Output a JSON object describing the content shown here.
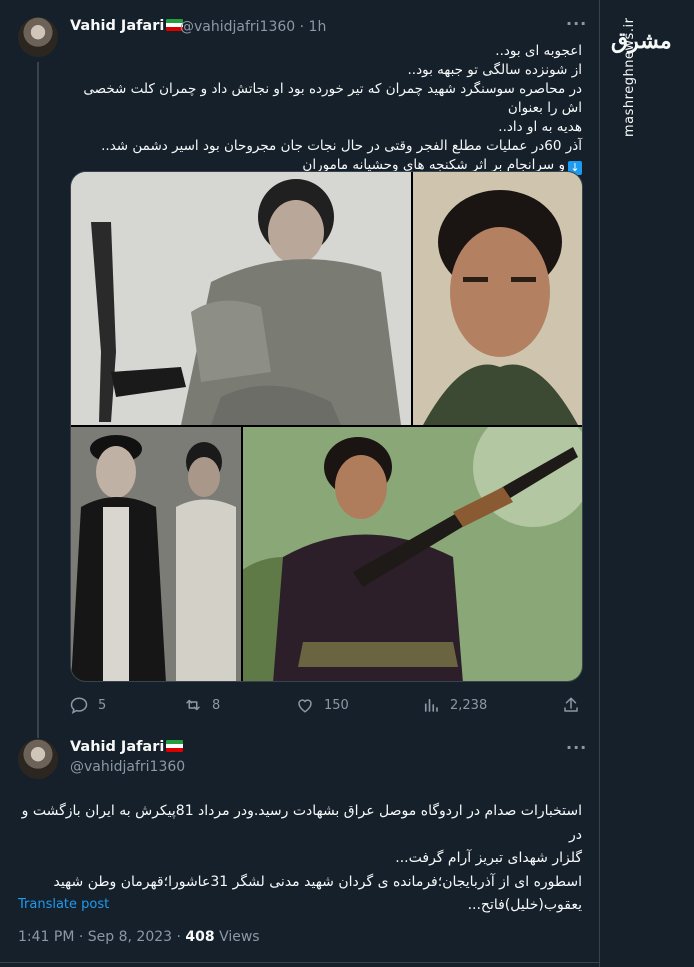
{
  "tweet1": {
    "name": "Vahid Jafari",
    "handle": "@vahidjafri1360 · 1h",
    "lines": [
      "اعجوبه ای بود..",
      "از شونزده سالگی تو جبهه بود..",
      "در محاصره سوسنگرد شهید چمران که تیر خورده بود او نجاتش داد و چمران کلت شخصی اش را بعنوان",
      "هدیه به او داد..",
      "آذر 60در عملیات مطلع الفجر وقتی در حال نجات جان مجروحان بود اسیر دشمن شد..",
      "و سرانجام بر اثر شکنجه های وحشیانه ماموران"
    ],
    "stats": {
      "replies": "5",
      "retweets": "8",
      "likes": "150",
      "views": "2,238"
    }
  },
  "tweet2": {
    "name": "Vahid Jafari",
    "handle": "@vahidjafri1360",
    "lines": [
      "استخبارات صدام در اردوگاه موصل عراق بشهادت رسید.ودر مرداد 81پیکرش به ایران بازگشت و در",
      "گلزار شهدای تبریز آرام گرفت...",
      "اسطوره ای از آذربایجان؛فرمانده ی گردان شهید مدنی لشگر 31عاشورا؛قهرمان وطن شهید",
      "یعقوب(خلیل)فاتح..."
    ],
    "translate": "Translate post",
    "timestamp": "1:41 PM · Sep 8, 2023 · ",
    "views_count": "408",
    "views_label": " Views"
  },
  "watermark": {
    "brand": "mashreghnews.ir",
    "logo": "مشرق"
  },
  "colors": {
    "background": "#15202b",
    "secondary_text": "#8b98a5",
    "accent": "#1d9bf0",
    "divider": "#38444d"
  },
  "icons": [
    "reply-icon",
    "retweet-icon",
    "like-icon",
    "views-icon",
    "share-icon",
    "more-icon",
    "flag-iran-icon"
  ]
}
